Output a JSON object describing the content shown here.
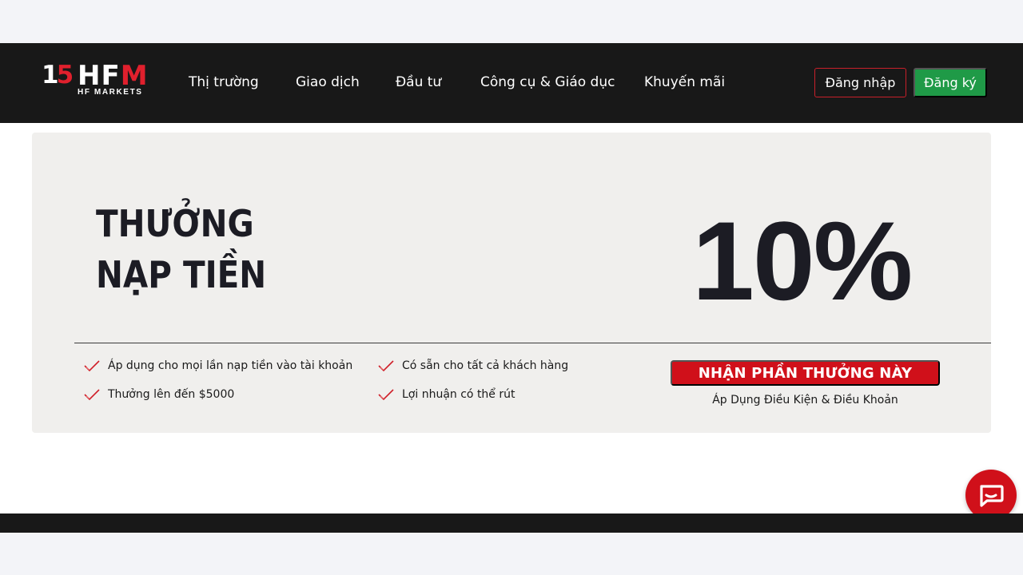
{
  "brand": {
    "logo_num_left": "1",
    "logo_num_right": "5",
    "logo_hf": "HF",
    "logo_m": "M",
    "logo_sub": "HF MARKETS",
    "accent": "#e0202d"
  },
  "nav": {
    "items": [
      {
        "label": "Thị trường"
      },
      {
        "label": "Giao dịch"
      },
      {
        "label": "Đầu tư"
      },
      {
        "label": "Công cụ & Giáo dục"
      },
      {
        "label": "Khuyến mãi"
      }
    ],
    "login_label": "Đăng nhập",
    "register_label": "Đăng ký"
  },
  "banner": {
    "headline_line1": "THƯỞNG",
    "headline_line2": "NẠP TIỀN",
    "percent": "10%",
    "features": [
      {
        "text": "Áp dụng cho mọi lần nạp tiền vào tài khoản"
      },
      {
        "text": "Có sẵn cho tất cả khách hàng"
      },
      {
        "text": "Thưởng lên đến $5000"
      },
      {
        "text": "Lợi nhuận có thể rút"
      }
    ],
    "cta_label": "NHẬN PHẦN THƯỞNG NÀY",
    "terms_label": "Áp Dụng Điều Kiện & Điều Khoản"
  },
  "colors": {
    "navbar_bg": "#181818",
    "cta_bg": "#d0101a",
    "register_bg": "#1f9a47",
    "banner_bg": "#f0efed"
  },
  "icons": {
    "feature": "check-icon",
    "chat": "chat-bubble-icon"
  }
}
